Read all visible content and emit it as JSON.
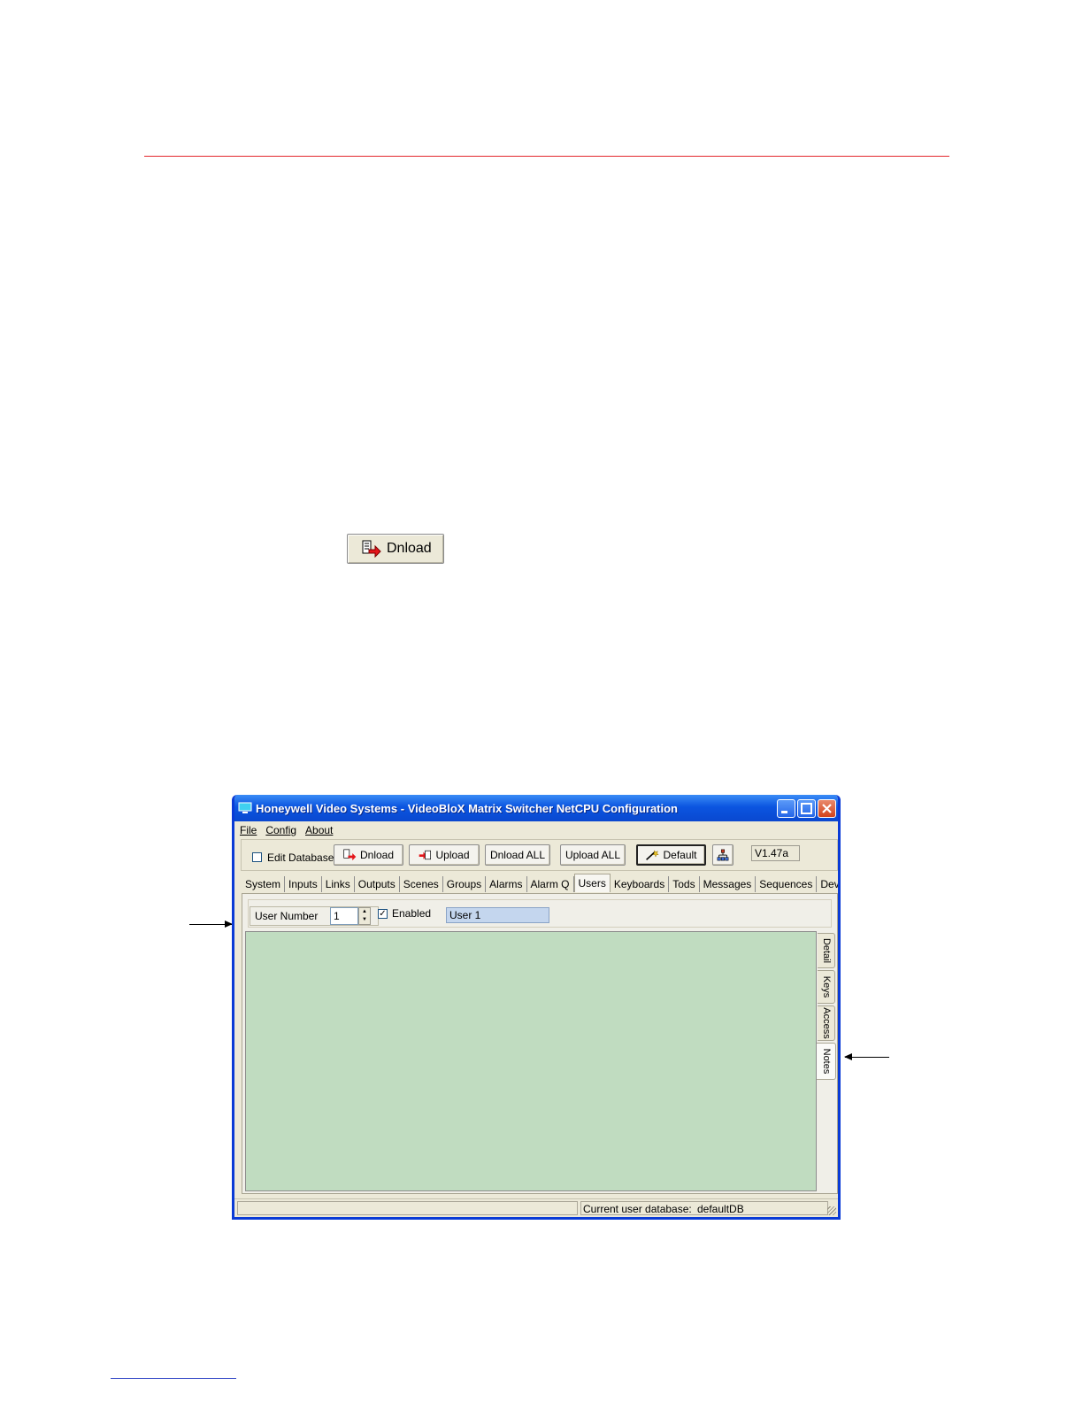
{
  "figure_button": {
    "label": "Dnload",
    "icon": "download-icon"
  },
  "window": {
    "title": "Honeywell Video Systems - VideoBloX Matrix Switcher NetCPU Configuration",
    "menu": [
      "File",
      "Config",
      "About"
    ],
    "toolbar": {
      "edit_database_label": "Edit Database",
      "edit_database_checked": false,
      "dnload_label": "Dnload",
      "upload_label": "Upload",
      "dnload_all_label": "Dnload ALL",
      "upload_all_label": "Upload ALL",
      "default_label": "Default",
      "version": "V1.47a"
    },
    "tabs": [
      "System",
      "Inputs",
      "Links",
      "Outputs",
      "Scenes",
      "Groups",
      "Alarms",
      "Alarm Q",
      "Users",
      "Keyboards",
      "Tods",
      "Messages",
      "Sequences",
      "Devices"
    ],
    "active_tab": "Users",
    "user": {
      "number_label": "User Number",
      "number_value": "1",
      "enabled_label": "Enabled",
      "enabled_checked": true,
      "name_value": "User 1"
    },
    "side_tabs": [
      "Detail",
      "Keys",
      "Access",
      "Notes"
    ],
    "active_side_tab": "Notes",
    "notes_area_color": "#c0dcc0",
    "status": {
      "database_label": "Current user database:",
      "database_value": "defaultDB"
    }
  },
  "colors": {
    "header_rule": "#e3262d",
    "title_bar": "#0b55e0"
  }
}
